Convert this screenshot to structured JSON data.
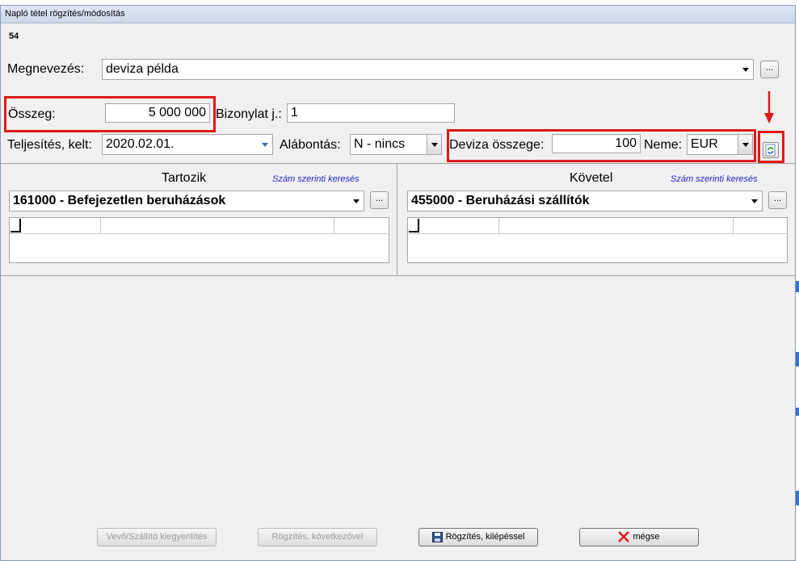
{
  "window": {
    "title": "Napló tétel rögzítés/módosítás",
    "record_id": "54"
  },
  "form": {
    "name_label": "Megnevezés:",
    "name_value": "deviza példa",
    "amount_label": "Összeg:",
    "amount_value": "5 000 000",
    "doc_label": "Bizonylat j.:",
    "doc_value": "1",
    "date_label": "Teljesítés, kelt:",
    "date_value": "2020.02.01.",
    "sub_label": "Alábontás:",
    "sub_value": "N - nincs",
    "fx_label": "Deviza összege:",
    "fx_value": "100",
    "currency_label": "Neme:",
    "currency_value": "EUR",
    "dots": "..."
  },
  "debit": {
    "header": "Tartozik",
    "search_link": "Szám szerinti keresés",
    "account": "161000 - Befejezetlen beruházások"
  },
  "credit": {
    "header": "Követel",
    "search_link": "Szám szerinti keresés",
    "account": "455000 - Beruházási szállítók"
  },
  "buttons": {
    "settle": "Vevő/Szállító kiegyenlítés",
    "save_next": "Rögzítés, következővel",
    "save_exit": "Rögzítés, kilépéssel",
    "cancel": "mégse"
  },
  "colors": {
    "highlight": "#e01818",
    "link": "#2424c8"
  }
}
